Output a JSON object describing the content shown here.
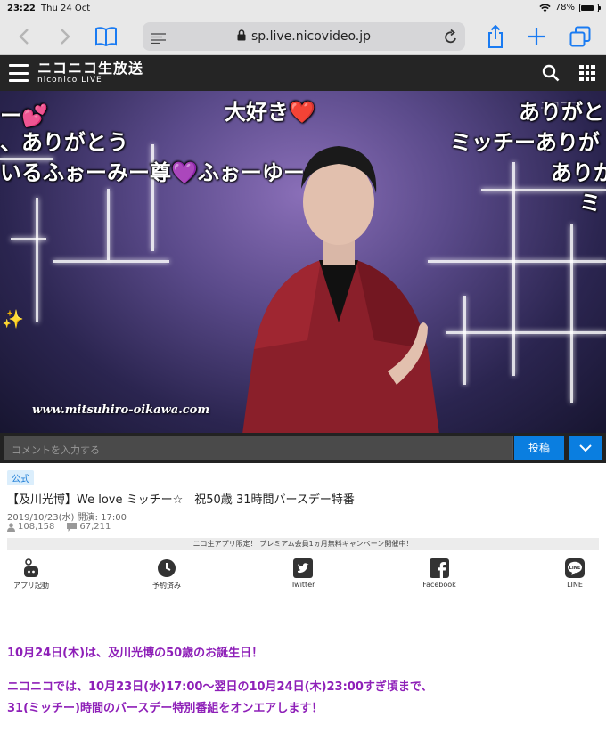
{
  "status_bar": {
    "time": "23:22",
    "date": "Thu 24 Oct",
    "battery": "78%",
    "battery_level": 0.78
  },
  "browser": {
    "url": "sp.live.nicovideo.jp"
  },
  "site_header": {
    "logo_line1": "ニコニコ生放送",
    "logo_line2": "niconico LIVE"
  },
  "video": {
    "watermark": "www.mitsuhiro-oikawa.com",
    "comments": [
      "ー💕",
      "大好き❤️",
      "ありがと",
      "、ありがとう",
      "ミッチーありが",
      "いるふぉーみー尊💜ふぉーゆー",
      "ありが",
      "ミ"
    ]
  },
  "comment_bar": {
    "placeholder": "コメントを入力する",
    "submit_label": "投稿"
  },
  "program": {
    "badge": "公式",
    "title": "【及川光博】We love ミッチー☆　祝50歳 31時間バースデー特番",
    "datetime": "2019/10/23(水) 開演: 17:00",
    "viewers": "108,158",
    "comments_count": "67,211",
    "campaign": "ニコ生アプリ限定！ プレミアム会員1ヵ月無料キャンペーン開催中！"
  },
  "actions": [
    {
      "label": "アプリ起動",
      "icon": "app-launch-icon"
    },
    {
      "label": "予約済み",
      "icon": "clock-icon"
    },
    {
      "label": "Twitter",
      "icon": "twitter-icon"
    },
    {
      "label": "Facebook",
      "icon": "facebook-icon"
    },
    {
      "label": "LINE",
      "icon": "line-icon"
    }
  ],
  "description": {
    "line1": "10月24日(木)は、及川光博の50歳のお誕生日！",
    "line2": "ニコニコでは、10月23日(水)17:00～翌日の10月24日(木)23:00すぎ頃まで、",
    "line3": "31(ミッチー)時間のバースデー特別番組をオンエアします！"
  },
  "colors": {
    "accent_blue": "#0a7ee0",
    "description_purple": "#8e1fb8",
    "header_dark": "#252525"
  }
}
